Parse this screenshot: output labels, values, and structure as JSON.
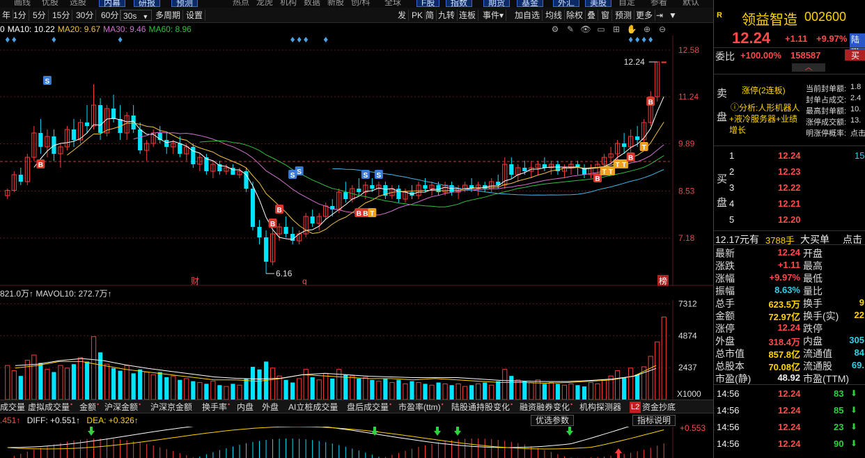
{
  "top_menu": [
    "画线",
    "优股",
    "选股",
    "内幕",
    "研报",
    "预测",
    "热点",
    "龙虎",
    "机构",
    "数据",
    "新股",
    "创/科",
    "全球",
    "F股",
    "指数",
    "期货",
    "基金",
    "外汇",
    "美股",
    "自定",
    "参看",
    "默认"
  ],
  "toolbar": {
    "items": [
      "年",
      "1分",
      "5分",
      "15分",
      "30分",
      "60分"
    ],
    "dropdown": "30s",
    "dropdown_arrow": "▼",
    "items2": [
      "多周期",
      "设置"
    ],
    "right_items": [
      "发",
      "PK",
      "简",
      "九转",
      "连板",
      "事件▾",
      "加自选",
      "均线",
      "除权",
      "叠",
      "窗",
      "预测",
      "更多"
    ],
    "icons": [
      "⇥",
      "▼"
    ]
  },
  "ma_legend": [
    {
      "text": "0",
      "color": "#ffffff"
    },
    {
      "text": "MA10: 10.22",
      "color": "#ffffff"
    },
    {
      "text": "MA20: 9.67",
      "color": "#f0c040"
    },
    {
      "text": "MA30: 9.46",
      "color": "#d070d0"
    },
    {
      "text": "MA60: 8.96",
      "color": "#30c040"
    }
  ],
  "ma_legend_extra": {
    "text": "",
    "color": "#40b8e8"
  },
  "chart_icons": [
    "⚙",
    "✎",
    "👁",
    "▭",
    "⊞",
    "✋",
    "⊕",
    "⊖"
  ],
  "price_axis": [
    "12.58",
    "11.24",
    "9.89",
    "8.53",
    "7.18"
  ],
  "price_annot": {
    "high_label": "12.24",
    "low_label": "6.16"
  },
  "markers_bottom": [
    "财",
    "q",
    "榜"
  ],
  "vol_legend": {
    "text": "821.0万↑ MAVOL10: 272.7万↑"
  },
  "vol_axis": [
    "7312",
    "4874",
    "2437",
    "X1000"
  ],
  "indicator_tabs": [
    "成交量",
    "虚拟成交量",
    "金额",
    "沪深金额",
    "沪深京金额",
    "换手率",
    "内盘",
    "外盘",
    "AI立桩成交量",
    "盘后成交量",
    "市盈率(ttm)",
    "陆股通持股变化",
    "融资融券变化",
    "机构探测器",
    "L2",
    "资金抄底"
  ],
  "macd_legend": {
    "p1": ".451↑",
    "p2": "DIFF: +0.551↑",
    "p3": "DEA: +0.326↑",
    "btn1": "优选参数",
    "btn2": "指标说明",
    "axis": "+0.553"
  },
  "colors": {
    "up": "#ff3b3b",
    "down": "#00e5ff",
    "bg": "#000000"
  },
  "chart_data": [
    {
      "type": "candlestick",
      "ylim": [
        5.8,
        13.0
      ],
      "y_ticks": [
        12.58,
        11.24,
        9.89,
        8.53,
        7.18
      ],
      "candles": [
        [
          8.4,
          8.6,
          8.3,
          8.55
        ],
        [
          8.55,
          9.1,
          8.5,
          9.0
        ],
        [
          9.0,
          9.2,
          8.7,
          8.8
        ],
        [
          8.8,
          9.6,
          8.7,
          9.5
        ],
        [
          9.5,
          10.4,
          9.4,
          10.2
        ],
        [
          10.2,
          10.6,
          9.6,
          9.8
        ],
        [
          9.8,
          10.3,
          9.5,
          10.1
        ],
        [
          10.1,
          10.3,
          9.4,
          9.6
        ],
        [
          9.6,
          9.9,
          9.2,
          9.8
        ],
        [
          9.8,
          10.4,
          9.7,
          10.3
        ],
        [
          10.3,
          10.6,
          9.8,
          10.0
        ],
        [
          10.0,
          10.6,
          9.9,
          10.5
        ],
        [
          10.5,
          11.0,
          10.2,
          10.4
        ],
        [
          10.4,
          11.6,
          10.3,
          11.0
        ],
        [
          11.0,
          11.2,
          10.0,
          10.2
        ],
        [
          10.2,
          11.0,
          10.1,
          10.9
        ],
        [
          10.9,
          11.3,
          10.5,
          10.6
        ],
        [
          10.6,
          11.0,
          10.0,
          10.2
        ],
        [
          10.2,
          10.8,
          10.0,
          10.7
        ],
        [
          10.7,
          11.0,
          10.2,
          10.3
        ],
        [
          10.3,
          10.5,
          9.6,
          9.7
        ],
        [
          9.7,
          10.0,
          9.4,
          9.9
        ],
        [
          9.9,
          10.3,
          9.8,
          10.2
        ],
        [
          10.2,
          10.4,
          9.9,
          10.0
        ],
        [
          10.0,
          10.2,
          9.6,
          9.8
        ],
        [
          9.8,
          10.0,
          9.6,
          9.9
        ],
        [
          9.9,
          10.1,
          9.5,
          9.6
        ],
        [
          9.6,
          9.9,
          9.4,
          9.8
        ],
        [
          9.8,
          9.9,
          9.2,
          9.3
        ],
        [
          9.3,
          9.6,
          9.1,
          9.5
        ],
        [
          9.5,
          9.6,
          9.0,
          9.1
        ],
        [
          9.1,
          9.4,
          8.9,
          9.3
        ],
        [
          9.3,
          9.4,
          9.0,
          9.1
        ],
        [
          9.1,
          9.3,
          9.0,
          9.2
        ],
        [
          9.2,
          9.3,
          9.0,
          9.0
        ],
        [
          9.0,
          9.2,
          8.9,
          9.1
        ],
        [
          9.1,
          9.2,
          8.5,
          8.6
        ],
        [
          8.6,
          8.8,
          7.4,
          7.5
        ],
        [
          7.5,
          7.7,
          7.0,
          7.2
        ],
        [
          7.2,
          7.4,
          6.16,
          6.5
        ],
        [
          6.5,
          7.4,
          6.4,
          7.3
        ],
        [
          7.3,
          7.6,
          7.1,
          7.5
        ],
        [
          7.5,
          7.8,
          7.2,
          7.3
        ],
        [
          7.3,
          7.5,
          7.0,
          7.1
        ],
        [
          7.1,
          7.4,
          7.0,
          7.3
        ],
        [
          7.3,
          7.9,
          7.2,
          7.8
        ],
        [
          7.8,
          8.0,
          7.5,
          7.6
        ],
        [
          7.6,
          7.9,
          7.4,
          7.8
        ],
        [
          7.8,
          8.2,
          7.7,
          8.1
        ],
        [
          8.1,
          8.3,
          7.8,
          8.0
        ],
        [
          8.0,
          8.6,
          7.9,
          8.5
        ],
        [
          8.5,
          8.8,
          8.2,
          8.3
        ],
        [
          8.3,
          8.7,
          8.2,
          8.6
        ],
        [
          8.6,
          8.9,
          8.4,
          8.5
        ],
        [
          8.5,
          8.8,
          8.3,
          8.7
        ],
        [
          8.7,
          8.9,
          8.5,
          8.6
        ],
        [
          8.6,
          8.8,
          8.4,
          8.7
        ],
        [
          8.7,
          8.8,
          8.3,
          8.4
        ],
        [
          8.4,
          8.7,
          8.3,
          8.6
        ],
        [
          8.6,
          8.7,
          8.2,
          8.3
        ],
        [
          8.3,
          8.6,
          8.2,
          8.5
        ],
        [
          8.5,
          8.7,
          8.3,
          8.4
        ],
        [
          8.4,
          8.8,
          8.3,
          8.7
        ],
        [
          8.7,
          8.9,
          8.5,
          8.6
        ],
        [
          8.6,
          8.8,
          8.4,
          8.7
        ],
        [
          8.7,
          8.8,
          8.4,
          8.5
        ],
        [
          8.5,
          8.8,
          8.4,
          8.7
        ],
        [
          8.7,
          8.8,
          8.4,
          8.5
        ],
        [
          8.5,
          8.7,
          8.3,
          8.6
        ],
        [
          8.6,
          8.8,
          8.5,
          8.7
        ],
        [
          8.7,
          8.9,
          8.5,
          8.6
        ],
        [
          8.6,
          8.8,
          8.4,
          8.7
        ],
        [
          8.7,
          8.8,
          8.5,
          8.6
        ],
        [
          8.6,
          8.9,
          8.5,
          8.8
        ],
        [
          8.8,
          9.0,
          8.6,
          8.7
        ],
        [
          8.7,
          9.5,
          8.6,
          9.3
        ],
        [
          9.3,
          9.5,
          8.9,
          9.0
        ],
        [
          9.0,
          9.3,
          8.8,
          9.2
        ],
        [
          9.2,
          9.4,
          9.0,
          9.1
        ],
        [
          9.1,
          9.4,
          8.9,
          9.2
        ],
        [
          9.2,
          9.4,
          9.0,
          9.3
        ],
        [
          9.3,
          9.5,
          9.1,
          9.2
        ],
        [
          9.2,
          9.4,
          9.0,
          9.3
        ],
        [
          9.3,
          9.4,
          9.0,
          9.1
        ],
        [
          9.1,
          9.3,
          8.9,
          9.2
        ],
        [
          9.2,
          9.4,
          9.0,
          9.3
        ],
        [
          9.3,
          9.4,
          9.0,
          9.2
        ],
        [
          9.2,
          9.3,
          8.9,
          9.0
        ],
        [
          9.0,
          9.3,
          8.9,
          9.2
        ],
        [
          9.2,
          9.4,
          9.0,
          9.3
        ],
        [
          9.3,
          9.6,
          9.1,
          9.5
        ],
        [
          9.5,
          9.8,
          9.3,
          9.6
        ],
        [
          9.6,
          10.0,
          9.4,
          9.9
        ],
        [
          9.9,
          10.2,
          9.6,
          9.8
        ],
        [
          9.8,
          10.3,
          9.6,
          10.1
        ],
        [
          10.1,
          10.4,
          9.8,
          10.0
        ],
        [
          10.0,
          10.6,
          9.9,
          10.5
        ],
        [
          10.5,
          11.4,
          10.4,
          11.24
        ],
        [
          11.24,
          12.24,
          11.1,
          12.24
        ],
        [
          12.24,
          12.24,
          12.24,
          12.24
        ]
      ],
      "markers": [
        "S",
        "S",
        "S",
        "S",
        "S",
        "B",
        "B",
        "B",
        "B",
        "B",
        "B",
        "B",
        "T",
        "T",
        "T",
        "T",
        "T",
        "T"
      ]
    },
    {
      "type": "bar",
      "name": "volume",
      "ylim": [
        0,
        7600
      ],
      "values": [
        2600,
        2200,
        1800,
        3000,
        3400,
        2800,
        2300,
        2100,
        2600,
        2400,
        2700,
        3200,
        2900,
        4800,
        3600,
        2700,
        2400,
        2200,
        2600,
        2000,
        2300,
        2100,
        1900,
        2100,
        1700,
        1800,
        1500,
        1600,
        1400,
        1300,
        1200,
        1400,
        1100,
        1000,
        1200,
        1100,
        1600,
        2500,
        2300,
        2900,
        2400,
        1800,
        1500,
        1300,
        1600,
        2300,
        1700,
        1500,
        2000,
        1600,
        2300,
        1900,
        1800,
        1600,
        1700,
        1500,
        1400,
        1600,
        1300,
        1500,
        1200,
        1400,
        1300,
        1200,
        1100,
        1300,
        1200,
        1100,
        1200,
        1000,
        1100,
        1200,
        1300,
        1100,
        1400,
        2300,
        1800,
        1500,
        1400,
        1300,
        1500,
        1200,
        1300,
        1200,
        1100,
        1200,
        1100,
        1000,
        1300,
        1200,
        1500,
        1800,
        2200,
        1700,
        2400,
        1900,
        2500,
        3300,
        4400,
        6300
      ],
      "mavol10": [
        2400,
        2600,
        2900,
        2900,
        2600,
        2300,
        2100,
        1900,
        1700,
        1500,
        1500,
        1400,
        1600,
        1900,
        1800,
        1700,
        1600,
        1600,
        1500,
        1600,
        1500,
        1400,
        1300,
        1300,
        1250,
        1300,
        1400,
        1500,
        1800,
        2600
      ]
    },
    {
      "type": "bar",
      "name": "macd",
      "ylim": [
        -0.6,
        0.6
      ]
    }
  ],
  "rpanel": {
    "header_r": "R",
    "name": "领益智造",
    "code": "002600",
    "price": "12.24",
    "change": "+1.11",
    "pct": "+9.97%",
    "tag": "陆股",
    "wb_label": "委比",
    "wb_pct": "+100.00%",
    "wb_val": "158587",
    "buy_btn": "买",
    "sell_side": [
      "卖",
      "盘"
    ],
    "limit_title": "涨停(2连板)",
    "analysis": "分析:人形机器人+液冷服务器+业绩增长",
    "analysis_marker": "ⓘ",
    "limit_stats": [
      {
        "k": "当前封单额:",
        "v": "1.8"
      },
      {
        "k": "封单占成交:",
        "v": "2.4"
      },
      {
        "k": "最高封单额:",
        "v": "10."
      },
      {
        "k": "涨停成交额:",
        "v": "13."
      },
      {
        "k": "明涨停概率:",
        "v": "点击"
      }
    ],
    "buy_side": [
      "买",
      "盘"
    ],
    "bids": [
      {
        "n": "1",
        "p": "12.24",
        "v": "15"
      },
      {
        "n": "2",
        "p": "12.23",
        "v": ""
      },
      {
        "n": "3",
        "p": "12.22",
        "v": ""
      },
      {
        "n": "4",
        "p": "12.21",
        "v": ""
      },
      {
        "n": "5",
        "p": "12.20",
        "v": ""
      }
    ],
    "bigorder": {
      "a": "12.17元有",
      "b": "3788手",
      "c": "大买单",
      "d": "点击"
    },
    "quotes": [
      {
        "k": "最新",
        "v": "12.24",
        "k2": "开盘",
        "v2": "",
        "vc": "red"
      },
      {
        "k": "涨跌",
        "v": "+1.11",
        "k2": "最高",
        "v2": "",
        "vc": "red"
      },
      {
        "k": "涨幅",
        "v": "+9.97%",
        "k2": "最低",
        "v2": "",
        "vc": "red"
      },
      {
        "k": "振幅",
        "v": "8.63%",
        "k2": "量比",
        "v2": "",
        "vc": "cyan"
      },
      {
        "k": "总手",
        "v": "623.5万",
        "k2": "换手",
        "v2": "9",
        "vc": "yellow"
      },
      {
        "k": "金额",
        "v": "72.97亿",
        "k2": "换手(实)",
        "v2": "22",
        "vc": "yellow"
      },
      {
        "k": "涨停",
        "v": "12.24",
        "k2": "跌停",
        "v2": "",
        "vc": "red"
      },
      {
        "k": "外盘",
        "v": "318.4万",
        "k2": "内盘",
        "v2": "305",
        "vc": "red"
      },
      {
        "k": "总市值",
        "v": "857.8亿",
        "k2": "流通值",
        "v2": "84",
        "vc": "yellow"
      },
      {
        "k": "总股本",
        "v": "70.08亿",
        "k2": "流通股",
        "v2": "69.",
        "vc": "yellow"
      },
      {
        "k": "市盈(静)",
        "v": "48.92",
        "k2": "市盈(TTM)",
        "v2": "",
        "vc": "white"
      }
    ],
    "ticks": [
      {
        "t": "14:56",
        "p": "12.24",
        "v": "83"
      },
      {
        "t": "14:56",
        "p": "12.24",
        "v": "85"
      },
      {
        "t": "14:56",
        "p": "12.24",
        "v": "23"
      },
      {
        "t": "14:56",
        "p": "12.24",
        "v": "90"
      }
    ]
  }
}
